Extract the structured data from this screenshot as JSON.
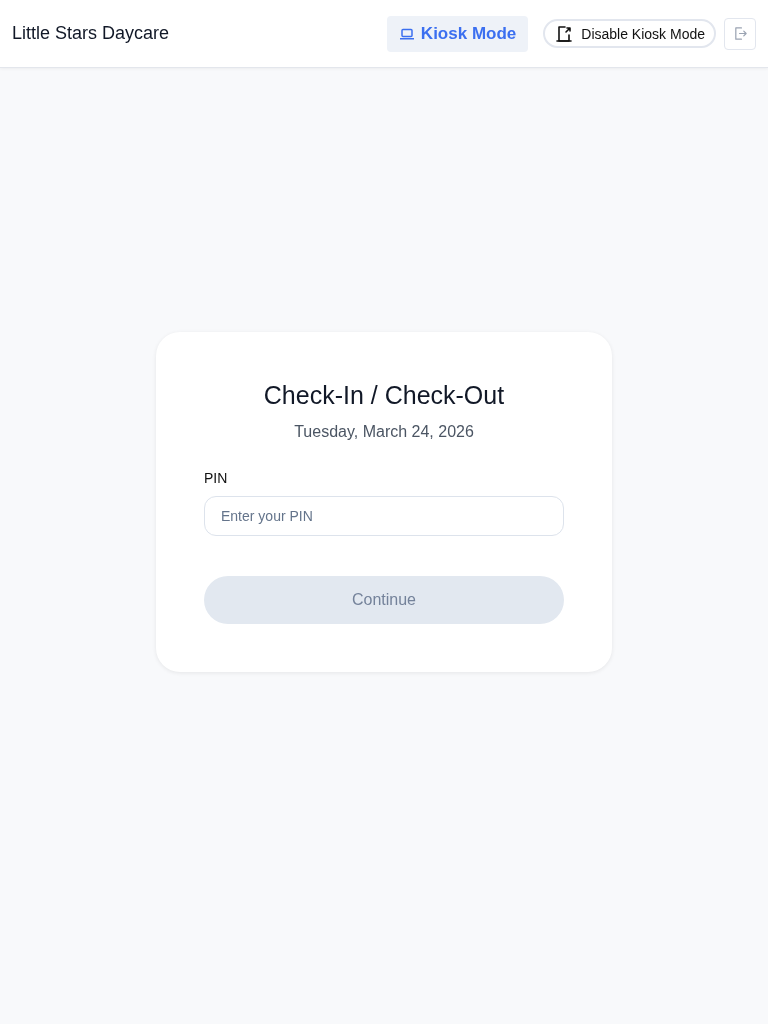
{
  "header": {
    "title": "Little Stars Daycare",
    "mode_badge": "Kiosk Mode",
    "disable_button": "Disable Kiosk Mode"
  },
  "card": {
    "title": "Check-In / Check-Out",
    "date": "Tuesday, March 24, 2026",
    "pin_field": {
      "label": "PIN",
      "placeholder": "Enter your PIN"
    },
    "continue_button": {
      "label": "Continue",
      "disabled": true
    }
  }
}
